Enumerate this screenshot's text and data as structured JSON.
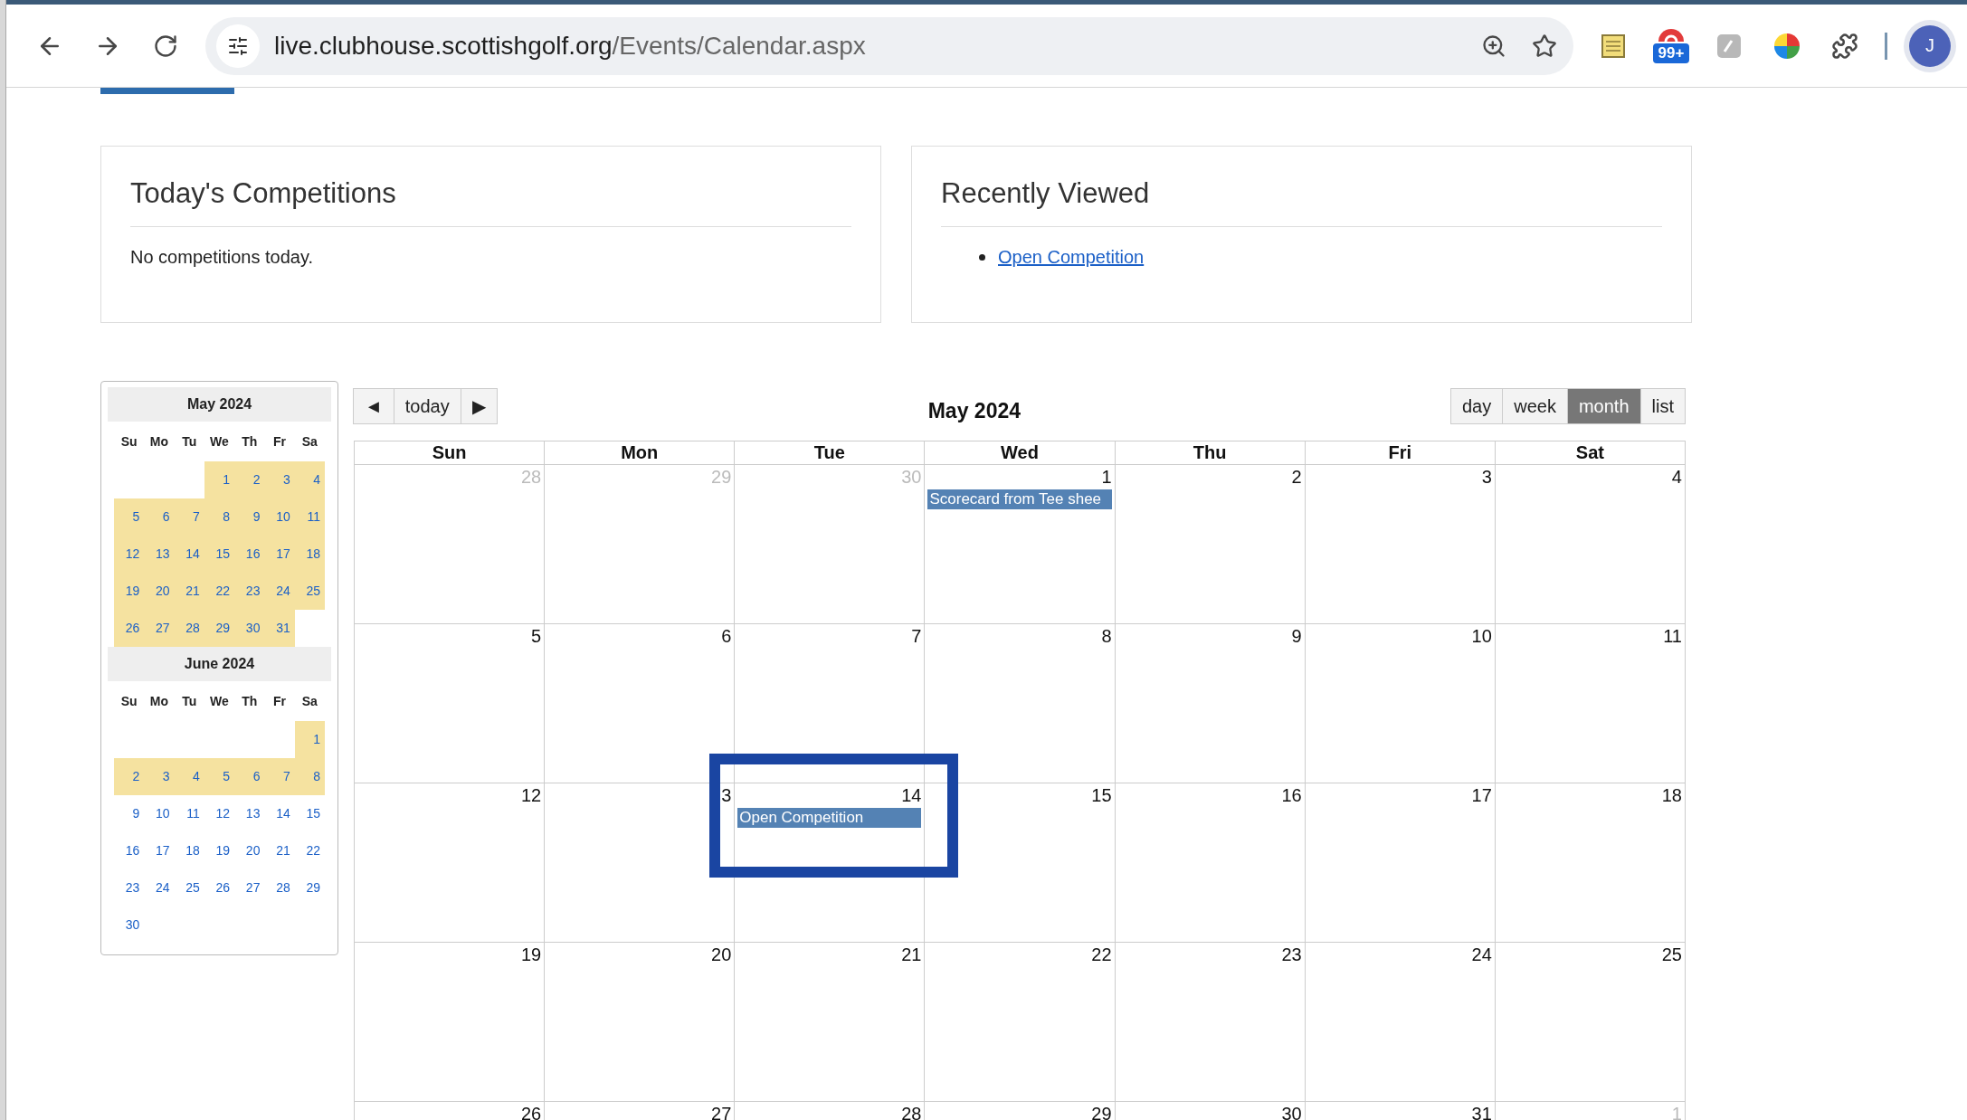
{
  "browser": {
    "url_host": "live.clubhouse.scottishgolf.org",
    "url_path": "/Events/Calendar.aspx",
    "extension_badge": "99+",
    "profile_initial": "J"
  },
  "todays_competitions": {
    "title": "Today's Competitions",
    "text": "No competitions today."
  },
  "recently_viewed": {
    "title": "Recently Viewed",
    "links": [
      "Open Competition"
    ]
  },
  "mini_calendars": [
    {
      "title": "May 2024",
      "weekdays": [
        "Su",
        "Mo",
        "Tu",
        "We",
        "Th",
        "Fr",
        "Sa"
      ],
      "weeks": [
        [
          {
            "day": "1",
            "highlighted": true
          },
          {
            "day": "2",
            "highlighted": true
          },
          {
            "day": "3",
            "highlighted": true
          },
          {
            "day": "4",
            "highlighted": true
          }
        ],
        [
          {
            "day": "5",
            "highlighted": true
          },
          {
            "day": "6",
            "highlighted": true
          },
          {
            "day": "7",
            "highlighted": true
          },
          {
            "day": "8",
            "highlighted": true
          },
          {
            "day": "9",
            "highlighted": true
          },
          {
            "day": "10",
            "highlighted": true
          },
          {
            "day": "11",
            "highlighted": true
          }
        ],
        [
          {
            "day": "12",
            "highlighted": true
          },
          {
            "day": "13",
            "highlighted": true
          },
          {
            "day": "14",
            "highlighted": true
          },
          {
            "day": "15",
            "highlighted": true
          },
          {
            "day": "16",
            "highlighted": true
          },
          {
            "day": "17",
            "highlighted": true
          },
          {
            "day": "18",
            "highlighted": true
          }
        ],
        [
          {
            "day": "19",
            "highlighted": true
          },
          {
            "day": "20",
            "highlighted": true
          },
          {
            "day": "21",
            "highlighted": true
          },
          {
            "day": "22",
            "highlighted": true
          },
          {
            "day": "23",
            "highlighted": true
          },
          {
            "day": "24",
            "highlighted": true
          },
          {
            "day": "25",
            "highlighted": true
          }
        ],
        [
          {
            "day": "26",
            "highlighted": true
          },
          {
            "day": "27",
            "highlighted": true
          },
          {
            "day": "28",
            "highlighted": true
          },
          {
            "day": "29",
            "highlighted": true
          },
          {
            "day": "30",
            "highlighted": true
          },
          {
            "day": "31",
            "highlighted": true
          }
        ]
      ]
    },
    {
      "title": "June 2024",
      "weekdays": [
        "Su",
        "Mo",
        "Tu",
        "We",
        "Th",
        "Fr",
        "Sa"
      ],
      "weeks": [
        [
          {
            "day": "1",
            "highlighted": true
          }
        ],
        [
          {
            "day": "2",
            "highlighted": true
          },
          {
            "day": "3",
            "highlighted": true
          },
          {
            "day": "4",
            "highlighted": true
          },
          {
            "day": "5",
            "highlighted": true
          },
          {
            "day": "6",
            "highlighted": true
          },
          {
            "day": "7",
            "highlighted": true
          },
          {
            "day": "8",
            "highlighted": true
          }
        ],
        [
          {
            "day": "9",
            "highlighted": false
          },
          {
            "day": "10",
            "highlighted": false
          },
          {
            "day": "11",
            "highlighted": false
          },
          {
            "day": "12",
            "highlighted": false
          },
          {
            "day": "13",
            "highlighted": false
          },
          {
            "day": "14",
            "highlighted": false
          },
          {
            "day": "15",
            "highlighted": false
          }
        ],
        [
          {
            "day": "16",
            "highlighted": false
          },
          {
            "day": "17",
            "highlighted": false
          },
          {
            "day": "18",
            "highlighted": false
          },
          {
            "day": "19",
            "highlighted": false
          },
          {
            "day": "20",
            "highlighted": false
          },
          {
            "day": "21",
            "highlighted": false
          },
          {
            "day": "22",
            "highlighted": false
          }
        ],
        [
          {
            "day": "23",
            "highlighted": false
          },
          {
            "day": "24",
            "highlighted": false
          },
          {
            "day": "25",
            "highlighted": false
          },
          {
            "day": "26",
            "highlighted": false
          },
          {
            "day": "27",
            "highlighted": false
          },
          {
            "day": "28",
            "highlighted": false
          },
          {
            "day": "29",
            "highlighted": false
          }
        ],
        [
          {
            "day": "30",
            "highlighted": false
          }
        ]
      ]
    }
  ],
  "calendar": {
    "nav_buttons": [
      "◄",
      "today",
      "▶"
    ],
    "title": "May 2024",
    "views": [
      {
        "label": "day",
        "selected": false
      },
      {
        "label": "week",
        "selected": false
      },
      {
        "label": "month",
        "selected": true
      },
      {
        "label": "list",
        "selected": false
      }
    ],
    "weekdays": [
      "Sun",
      "Mon",
      "Tue",
      "Wed",
      "Thu",
      "Fri",
      "Sat"
    ],
    "weeks": [
      [
        {
          "day": "28",
          "other_month": true
        },
        {
          "day": "29",
          "other_month": true
        },
        {
          "day": "30",
          "other_month": true
        },
        {
          "day": "1",
          "other_month": false,
          "events": [
            "Scorecard from Tee shee"
          ]
        },
        {
          "day": "2",
          "other_month": false
        },
        {
          "day": "3",
          "other_month": false
        },
        {
          "day": "4",
          "other_month": false
        }
      ],
      [
        {
          "day": "5",
          "other_month": false
        },
        {
          "day": "6",
          "other_month": false
        },
        {
          "day": "7",
          "other_month": false
        },
        {
          "day": "8",
          "other_month": false
        },
        {
          "day": "9",
          "other_month": false
        },
        {
          "day": "10",
          "other_month": false
        },
        {
          "day": "11",
          "other_month": false
        }
      ],
      [
        {
          "day": "12",
          "other_month": false
        },
        {
          "day": "3",
          "other_month": false
        },
        {
          "day": "14",
          "other_month": false,
          "events": [
            "Open Competition"
          ]
        },
        {
          "day": "15",
          "other_month": false
        },
        {
          "day": "16",
          "other_month": false
        },
        {
          "day": "17",
          "other_month": false
        },
        {
          "day": "18",
          "other_month": false
        }
      ],
      [
        {
          "day": "19",
          "other_month": false
        },
        {
          "day": "20",
          "other_month": false
        },
        {
          "day": "21",
          "other_month": false
        },
        {
          "day": "22",
          "other_month": false
        },
        {
          "day": "23",
          "other_month": false
        },
        {
          "day": "24",
          "other_month": false
        },
        {
          "day": "25",
          "other_month": false
        }
      ],
      [
        {
          "day": "26",
          "other_month": false
        },
        {
          "day": "27",
          "other_month": false
        },
        {
          "day": "28",
          "other_month": false
        },
        {
          "day": "29",
          "other_month": false
        },
        {
          "day": "30",
          "other_month": false
        },
        {
          "day": "31",
          "other_month": false
        },
        {
          "day": "1",
          "other_month": true
        }
      ]
    ],
    "highlight_box": {
      "kind": "annotation"
    }
  }
}
